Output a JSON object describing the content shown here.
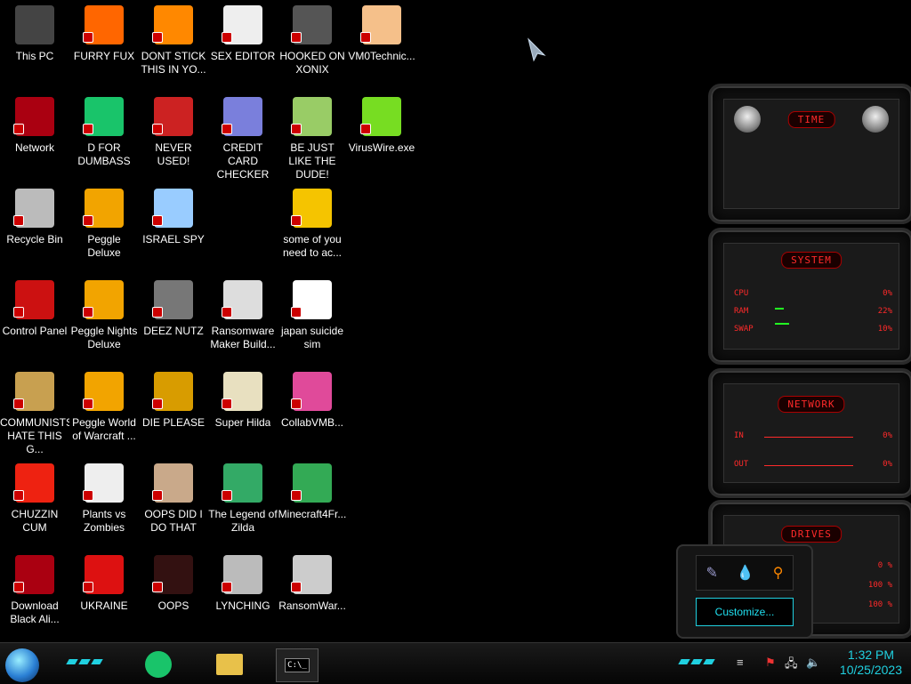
{
  "desktop_icons": [
    {
      "label": "This PC",
      "icon": "computer-icon"
    },
    {
      "label": "FURRY FUX",
      "icon": "firefox-icon"
    },
    {
      "label": "DONT STICK THIS IN YO...",
      "icon": "vlc-cone-icon"
    },
    {
      "label": "SEX EDITOR",
      "icon": "hxd-editor-icon"
    },
    {
      "label": "HOOKED ON XONIX",
      "icon": "xonix-game-icon"
    },
    {
      "label": "VM0Technic...",
      "icon": "doctor-icon"
    },
    {
      "label": "Network",
      "icon": "network-icon"
    },
    {
      "label": "D FOR DUMBASS",
      "icon": "chat-icon"
    },
    {
      "label": "NEVER USED!",
      "icon": "dev-cpp-icon"
    },
    {
      "label": "CREDIT CARD CHECKER",
      "icon": "credit-card-icon"
    },
    {
      "label": "BE JUST LIKE THE DUDE!",
      "icon": "elf-icon"
    },
    {
      "label": "VirusWire.exe",
      "icon": "limewire-icon"
    },
    {
      "label": "Recycle Bin",
      "icon": "recycle-bin-icon"
    },
    {
      "label": "Peggle Deluxe",
      "icon": "peggle-icon"
    },
    {
      "label": "ISRAEL SPY",
      "icon": "network-spy-icon"
    },
    {
      "label": "some of you need to ac...",
      "icon": "dog-cartoon-icon"
    },
    {
      "label": "Control Panel",
      "icon": "control-panel-icon"
    },
    {
      "label": "Peggle Nights Deluxe",
      "icon": "peggle-icon"
    },
    {
      "label": "DEEZ NUTZ",
      "icon": "windows-stack-icon"
    },
    {
      "label": "Ransomware Maker Build...",
      "icon": "window-app-icon"
    },
    {
      "label": "japan suicide sim",
      "icon": "document-icon"
    },
    {
      "label": "COMMUNISTS HATE THIS G...",
      "icon": "money-bag-icon"
    },
    {
      "label": "Peggle World of Warcraft ...",
      "icon": "peggle-icon"
    },
    {
      "label": "DIE PLEASE",
      "icon": "de-letters-icon"
    },
    {
      "label": "Super Hilda",
      "icon": "pixel-character-icon"
    },
    {
      "label": "CollabVMB...",
      "icon": "monitor-pink-icon"
    },
    {
      "label": "CHUZZIN CUM",
      "icon": "chuzzle-icon"
    },
    {
      "label": "Plants vs Zombies",
      "icon": "flower-icon"
    },
    {
      "label": "OOPS DID I DO THAT",
      "icon": "portrait-icon"
    },
    {
      "label": "The Legend of Zilda",
      "icon": "pixel-hero-icon"
    },
    {
      "label": "Minecraft4Fr...",
      "icon": "grass-block-icon"
    },
    {
      "label": "Download Black Ali...",
      "icon": "alien-network-icon"
    },
    {
      "label": "UKRAINE",
      "icon": "radiation-icon"
    },
    {
      "label": "OOPS",
      "icon": "alienware-monitor-icon"
    },
    {
      "label": "LYNCHING",
      "icon": "knot-icon"
    },
    {
      "label": "RansomWar...",
      "icon": "skull-ring-icon"
    }
  ],
  "gadgets": {
    "time": {
      "title": "TIME"
    },
    "system": {
      "title": "SYSTEM",
      "rows": [
        {
          "label": "CPU",
          "value": "0%"
        },
        {
          "label": "RAM",
          "value": "22%"
        },
        {
          "label": "SWAP",
          "value": "10%"
        }
      ]
    },
    "network": {
      "title": "NETWORK",
      "rows": [
        {
          "label": "IN",
          "value": "0%"
        },
        {
          "label": "OUT",
          "value": "0%"
        }
      ]
    },
    "drives": {
      "title": "DRIVES",
      "rows": [
        {
          "value": "0 %"
        },
        {
          "value": "100 %"
        },
        {
          "value": "100 %"
        }
      ]
    }
  },
  "popup": {
    "customize_label": "Customize..."
  },
  "taskbar": {
    "time": "1:32 PM",
    "date": "10/25/2023"
  },
  "colors": {
    "accent_red": "#ff2a2a",
    "accent_cyan": "#20d0e0"
  }
}
